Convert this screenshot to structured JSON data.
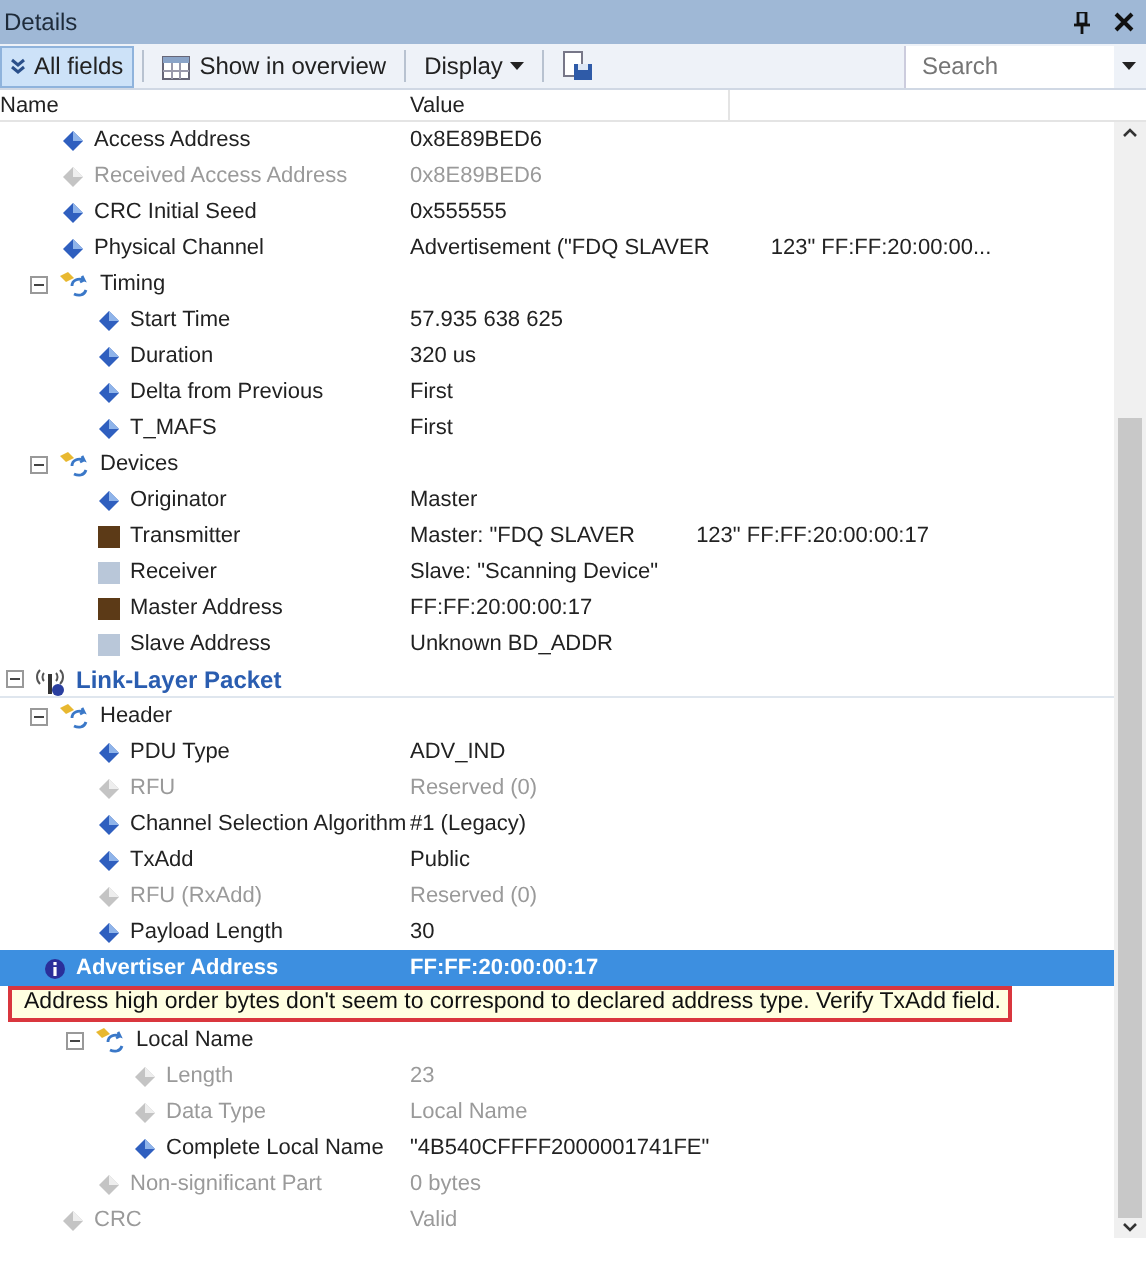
{
  "window": {
    "title": "Details"
  },
  "toolbar": {
    "all_fields": {
      "label": "All fields",
      "selected": true
    },
    "show_in_overview": {
      "label": "Show in overview"
    },
    "display": {
      "label": "Display"
    },
    "search": {
      "placeholder": "Search"
    }
  },
  "columns": [
    "Name",
    "Value"
  ],
  "tree": [
    {
      "kind": "field",
      "name": "Access Address",
      "value": "0x8E89BED6",
      "disabled": false,
      "selected": false
    },
    {
      "kind": "field",
      "name": "Received Access Address",
      "value": "0x8E89BED6",
      "disabled": true,
      "selected": false
    },
    {
      "kind": "field",
      "name": "CRC Initial Seed",
      "value": "0x555555",
      "disabled": false,
      "selected": false
    },
    {
      "kind": "field",
      "name": "Physical Channel",
      "value": "Advertisement (\"FDQ SLAVER          123\" FF:FF:20:00:00...",
      "disabled": false,
      "selected": false
    },
    {
      "kind": "group",
      "name": "Timing",
      "expanded": true,
      "children": [
        {
          "kind": "field",
          "name": "Start Time",
          "value": "57.935 638 625",
          "disabled": false,
          "selected": false
        },
        {
          "kind": "field",
          "name": "Duration",
          "value": "320 us",
          "disabled": false,
          "selected": false
        },
        {
          "kind": "field",
          "name": "Delta from Previous",
          "value": "First",
          "disabled": false,
          "selected": false
        },
        {
          "kind": "field",
          "name": "T_MAFS",
          "value": "First",
          "disabled": false,
          "selected": false
        }
      ]
    },
    {
      "kind": "group",
      "name": "Devices",
      "expanded": true,
      "children": [
        {
          "kind": "field",
          "name": "Originator",
          "value": "Master",
          "disabled": false,
          "selected": false
        },
        {
          "kind": "swatch",
          "color": "#5c3a17",
          "name": "Transmitter",
          "value": "Master: \"FDQ SLAVER          123\" FF:FF:20:00:00:17",
          "disabled": false,
          "selected": false
        },
        {
          "kind": "swatch",
          "color": "#b9c7d9",
          "name": "Receiver",
          "value": "Slave: \"Scanning Device\"",
          "disabled": false,
          "selected": false
        },
        {
          "kind": "swatch",
          "color": "#5c3a17",
          "name": "Master Address",
          "value": "FF:FF:20:00:00:17",
          "disabled": false,
          "selected": false
        },
        {
          "kind": "swatch",
          "color": "#b9c7d9",
          "name": "Slave Address",
          "value": "Unknown BD_ADDR",
          "disabled": false,
          "selected": false
        }
      ]
    },
    {
      "kind": "section",
      "name": "Link-Layer Packet",
      "expanded": true,
      "children": [
        {
          "kind": "group",
          "name": "Header",
          "expanded": true,
          "children": [
            {
              "kind": "field",
              "name": "PDU Type",
              "value": "ADV_IND",
              "disabled": false,
              "selected": false
            },
            {
              "kind": "field",
              "name": "RFU",
              "value": "Reserved (0)",
              "disabled": true,
              "selected": false
            },
            {
              "kind": "field",
              "name": "Channel Selection Algorithm",
              "value": "#1 (Legacy)",
              "disabled": false,
              "selected": false
            },
            {
              "kind": "field",
              "name": "TxAdd",
              "value": "Public",
              "disabled": false,
              "selected": false
            },
            {
              "kind": "field",
              "name": "RFU (RxAdd)",
              "value": "Reserved (0)",
              "disabled": true,
              "selected": false
            },
            {
              "kind": "field",
              "name": "Payload Length",
              "value": "30",
              "disabled": false,
              "selected": false
            }
          ]
        },
        {
          "kind": "info",
          "name": "Advertiser Address",
          "value": "FF:FF:20:00:00:17",
          "disabled": false,
          "selected": true
        },
        {
          "kind": "covered",
          "tooltip": "Address high order bytes don't seem to correspond to declared address type. Verify TxAdd field.",
          "children": [
            {
              "kind": "group",
              "name": "Local Name",
              "expanded": true,
              "children": [
                {
                  "kind": "field",
                  "name": "Length",
                  "value": "23",
                  "disabled": true,
                  "selected": false
                },
                {
                  "kind": "field",
                  "name": "Data Type",
                  "value": "Local Name",
                  "disabled": true,
                  "selected": false
                },
                {
                  "kind": "field",
                  "name": "Complete Local Name",
                  "value": "\"4B540CFFFF2000001741FE\"",
                  "disabled": false,
                  "selected": false
                }
              ]
            },
            {
              "kind": "field",
              "name": "Non-significant Part",
              "value": "0 bytes",
              "disabled": true,
              "selected": false
            }
          ]
        },
        {
          "kind": "field",
          "name": "CRC",
          "value": "Valid",
          "disabled": true,
          "selected": false
        }
      ]
    }
  ]
}
